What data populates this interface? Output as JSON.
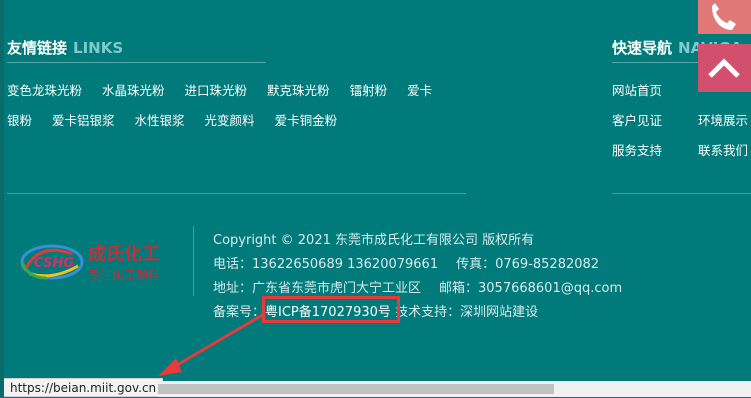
{
  "links": {
    "title_cn": "友情链接",
    "title_en": "LINKS",
    "row1": [
      "变色龙珠光粉",
      "水晶珠光粉",
      "进口珠光粉",
      "默克珠光粉",
      "镭射粉",
      "爱卡"
    ],
    "row2": [
      "银粉",
      "爱卡铝银浆",
      "水性银浆",
      "光变颜料",
      "爱卡铜金粉"
    ]
  },
  "nav": {
    "title_cn": "快速导航",
    "title_en": "NAVIGA",
    "items": [
      "网站首页",
      "客户见证",
      "环境展示",
      "服务支持",
      "联系我们"
    ]
  },
  "footer": {
    "copyright": "Copyright © 2021 东莞市成氏化工有限公司 版权所有",
    "phone": "电话：13622650689 13620079661",
    "fax": "传真：0769-85282082",
    "address": "地址：广东省东莞市虎门大宁工业区",
    "email": "邮箱：3057668601@qq.com",
    "icp_label": "备案号：",
    "icp": "粤ICP备17027930号",
    "support": "技术支持：深圳网站建设"
  },
  "logo": {
    "initials": "CSHG",
    "name": "成氏化工",
    "slogan": "专注化工颜料"
  },
  "status_bar": {
    "url": "https://beian.miit.gov.cn"
  },
  "colors": {
    "background": "#007a7a",
    "annotation_red": "#e83a3a",
    "up_button": "#d24f6e",
    "phone_button": "#e07878"
  }
}
